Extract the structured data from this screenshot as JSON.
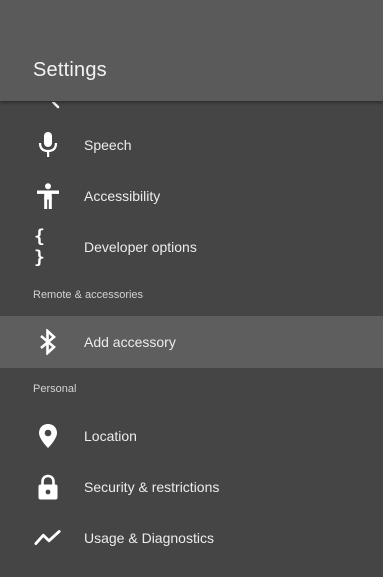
{
  "header": {
    "title": "Settings"
  },
  "items_top": [
    {
      "label": "Speech",
      "icon": "microphone-icon"
    },
    {
      "label": "Accessibility",
      "icon": "accessibility-icon"
    },
    {
      "label": "Developer options",
      "icon": "braces-icon",
      "glyph": "{ }"
    }
  ],
  "sections": [
    {
      "header": "Remote & accessories",
      "items": [
        {
          "label": "Add accessory",
          "icon": "bluetooth-icon",
          "selected": true
        }
      ]
    },
    {
      "header": "Personal",
      "items": [
        {
          "label": "Location",
          "icon": "location-pin-icon"
        },
        {
          "label": "Security & restrictions",
          "icon": "lock-icon"
        },
        {
          "label": "Usage & Diagnostics",
          "icon": "trending-line-icon"
        }
      ]
    }
  ],
  "colors": {
    "header_bg": "#5a5a5a",
    "list_bg": "#454545",
    "selected_bg": "#5e5e5e",
    "text": "#ececec",
    "section_text": "#d2d2d2"
  }
}
